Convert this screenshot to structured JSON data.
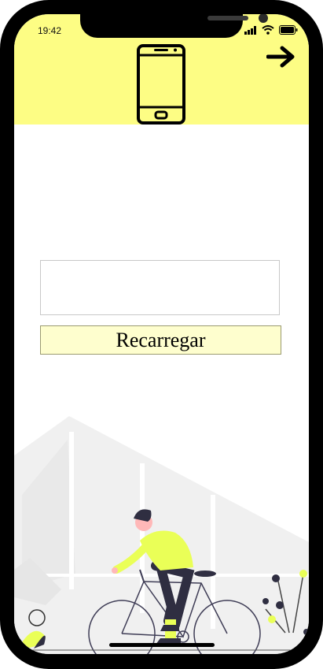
{
  "status_bar": {
    "time": "19:42",
    "icons": [
      "signal-icon",
      "wifi-icon",
      "battery-icon"
    ]
  },
  "header": {
    "background": "#fdfd84",
    "icon": "smartphone-icon",
    "next_icon": "arrow-right-icon"
  },
  "form": {
    "input_value": "",
    "reload_label": "Recarregar",
    "button_color": "#fefece"
  },
  "illustration": {
    "name": "cyclist-illustration",
    "accent": "#eaff57"
  }
}
